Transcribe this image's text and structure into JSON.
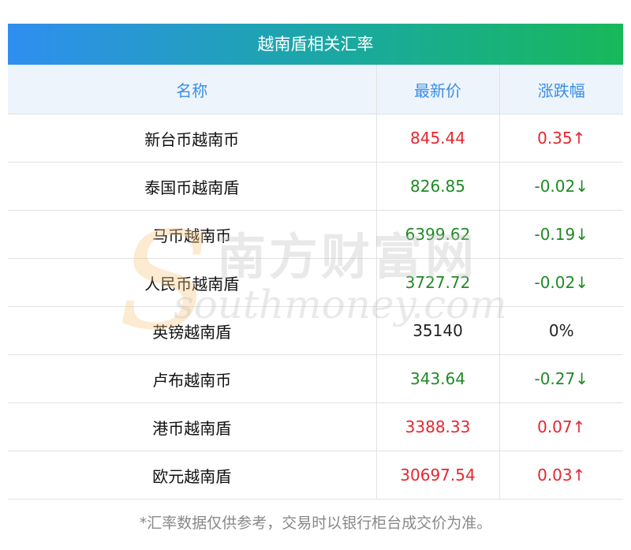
{
  "title": "越南盾相关汇率",
  "headers": [
    "名称",
    "最新价",
    "涨跌幅"
  ],
  "rows": [
    {
      "name": "新台币越南币",
      "price": "845.44",
      "change": "0.35↑",
      "dir": "up"
    },
    {
      "name": "泰国币越南盾",
      "price": "826.85",
      "change": "-0.02↓",
      "dir": "down"
    },
    {
      "name": "马币越南币",
      "price": "6399.62",
      "change": "-0.19↓",
      "dir": "down"
    },
    {
      "name": "人民币越南盾",
      "price": "3727.72",
      "change": "-0.02↓",
      "dir": "down"
    },
    {
      "name": "英镑越南盾",
      "price": "35140",
      "change": "0%",
      "dir": "flat"
    },
    {
      "name": "卢布越南币",
      "price": "343.64",
      "change": "-0.27↓",
      "dir": "down"
    },
    {
      "name": "港币越南盾",
      "price": "3388.33",
      "change": "0.07↑",
      "dir": "up"
    },
    {
      "name": "欧元越南盾",
      "price": "30697.54",
      "change": "0.03↑",
      "dir": "up"
    }
  ],
  "watermark": {
    "cn": "南方财富网",
    "en": "southmoney.com"
  },
  "footnote": "*汇率数据仅供参考，交易时以银行柜台成交价为准。",
  "colors": {
    "up": "#e8262f",
    "down": "#1f8a24",
    "header_text": "#3a8ee6",
    "title_gradient_start": "#2f8ef0",
    "title_gradient_end": "#18b85a"
  }
}
